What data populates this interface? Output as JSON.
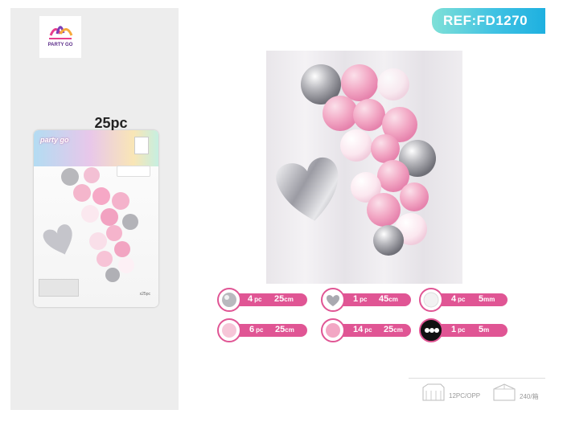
{
  "brand": {
    "logo_text": "PARTY GO"
  },
  "pack": {
    "count_label": "25pc",
    "card_logo": "party go",
    "card_tag": "x25pc"
  },
  "ref": {
    "label": "REF:FD1270"
  },
  "contents": [
    {
      "qty": "4",
      "unit": "pc",
      "size_value": "25",
      "size_unit": "cm",
      "kind": "silver-balloon-icon"
    },
    {
      "qty": "1",
      "unit": "pc",
      "size_value": "45",
      "size_unit": "cm",
      "kind": "heart-foil-icon"
    },
    {
      "qty": "4",
      "unit": "pc",
      "size_value": "5",
      "size_unit": "mm",
      "kind": "glue-dots-icon"
    },
    {
      "qty": "6",
      "unit": "pc",
      "size_value": "25",
      "size_unit": "cm",
      "kind": "pink-balloon-icon"
    },
    {
      "qty": "14",
      "unit": "pc",
      "size_value": "25",
      "size_unit": "cm",
      "kind": "pearl-balloon-icon"
    },
    {
      "qty": "1",
      "unit": "pc",
      "size_value": "5",
      "size_unit": "m",
      "kind": "tape-strip-icon"
    }
  ],
  "packaging": {
    "inner": "12PC/OPP",
    "outer": "240/箱"
  },
  "colors": {
    "accent_pink": "#e05594",
    "ref_cyan": "#1eb0e0",
    "panel_gray": "#ededed"
  }
}
